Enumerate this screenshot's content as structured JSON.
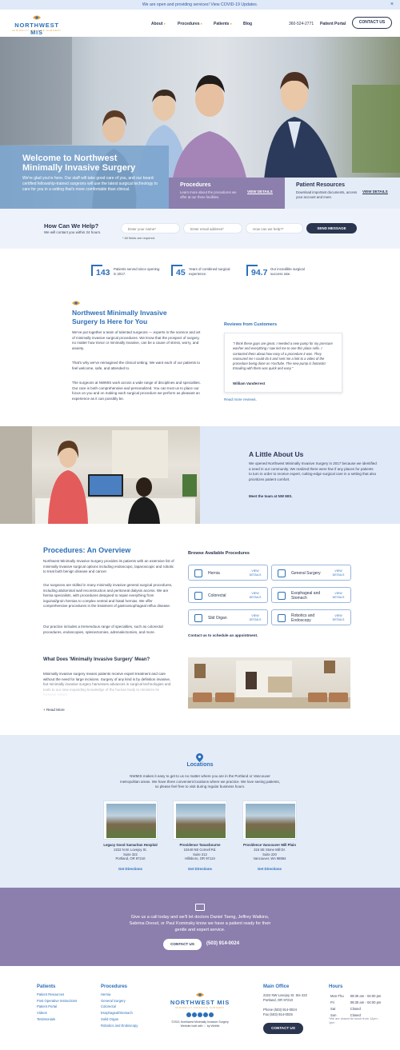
{
  "banner": {
    "text": "We are open and providing services! View COVID-19 Updates.",
    "close": "×"
  },
  "header": {
    "logo_name": "NORTHWEST MIS",
    "logo_tag": "MINIMALLY INVASIVE SURGERY",
    "nav": [
      "About",
      "Procedures",
      "Patients",
      "Blog"
    ],
    "phone": "360-524-2771",
    "portal": "Patient Portal",
    "contact_button": "CONTACT US"
  },
  "hero": {
    "title": "Welcome to Northwest Minimally Invasive Surgery",
    "text": "We're glad you're here. Our staff will take good care of you, and our board-certified fellowship-trained surgeons will use the latest surgical technology to care for you in a setting that's more comfortable than clinical.",
    "procedures": {
      "title": "Procedures",
      "text": "Learn more about the procedures we offer at our three facilities.",
      "link": "VIEW DETAILS"
    },
    "resources": {
      "title": "Patient Resources",
      "text": "Download important documents, access your account and more.",
      "link": "VIEW DETAILS"
    }
  },
  "help": {
    "title": "How Can We Help?",
    "subtitle": "We will contact you within 24 hours.",
    "name_placeholder": "Enter your name*",
    "email_placeholder": "Enter email address*",
    "message_placeholder": "How can we help?*",
    "send": "SEND MESSAGE",
    "required_note": "* All fields are required."
  },
  "stats": [
    {
      "num": "143",
      "label": "Patients served since opening in 2017."
    },
    {
      "num": "45",
      "label": "Years of combined surgical experience."
    },
    {
      "num": "94.7",
      "label": "Our incredible surgical success rate."
    }
  ],
  "intro": {
    "title": "Northwest Minimally Invasive Surgery Is Here for You",
    "p1": "We've put together a team of talented surgeons — experts in the science and art of minimally invasive surgical procedures. We know that the prospect of surgery, no matter how minor or minimally invasive, can be a cause of stress, worry, and anxiety.",
    "p2": "That's why we've reimagined the clinical setting. We want each of our patients to feel welcome, safe, and attended to.",
    "p3": "The surgeons at NWMIS work across a wide range of disciplines and specialties. Our care is both comprehensive and personalized. You can trust us to place our focus on you and on making each surgical procedure we perform as pleasant an experience as it can possibly be."
  },
  "reviews": {
    "title": "Reviews from Customers",
    "quote": "\"I think these guys are great.  I needed a new pump for my pressure washer and everything I saw led me to one this place sells.  I contacted them about how easy of a procedure it was. They reassured me I could do it and sent me a link to a video of the procedure being done on YouTube.  The new pump is fantastic!  Emailing with them was quick and easy.\"",
    "author": "William Vanderrest",
    "more": "Read more reviews."
  },
  "about": {
    "title": "A Little About Us",
    "text": "We opened Northwest Minimally Invasive Surgery in 2017 because we identified a need in our community. We realized there were few if any places for patients to turn in order to receive expert, cutting-edge surgical care in a setting that also prioritizes patient comfort.",
    "link": "Meet the team at NW MIS."
  },
  "procedures": {
    "title": "Procedures: An Overview",
    "p1": "Northwest Minimally Invasive Surgery provides its patients with an extensive list of minimally invasive surgical options including endoscopic, laparoscopic and robotic to treat both benign disease and cancer.",
    "p2": "Our surgeons are skilled in many minimally invasive general surgical procedures, including abdominal wall reconstruction and peritoneal dialysis access.  We are hernia specialists, with procedures designed to repair everything from inguinal/groin hernias to complex ventral and hiatal hernias.  We  offer comprehensive procedures in the treatment of gastroesophageal reflux disease.",
    "p3": "Our practice includes a tremendous range of specialties, such as colorectal procedures, endoscopies, splenectomies, adrenalectomies, and more.",
    "browse_title": "Browse Available Procedures",
    "cards": [
      {
        "name": "Hernia",
        "link": "VIEW DETAILS",
        "icon": "hernia-icon"
      },
      {
        "name": "General Surgery",
        "link": "VIEW DETAILS",
        "icon": "general-surgery-icon"
      },
      {
        "name": "Colorectal",
        "link": "VIEW DETAILS",
        "icon": "colorectal-icon"
      },
      {
        "name": "Esophageal and Stomach",
        "link": "VIEW DETAILS",
        "icon": "stomach-icon"
      },
      {
        "name": "Slid Organ",
        "link": "VIEW DETAILS",
        "icon": "organ-icon"
      },
      {
        "name": "Robotics and Endoscopy",
        "link": "VIEW DETAILS",
        "icon": "robotics-icon"
      }
    ],
    "contact_schedule": "Contact us to schedule an appointment.",
    "mis_title": "What Does 'Minimally Invasive Surgery' Mean?",
    "mis_text": "Minimally invasive surgery means patients receive expert treatment and care without the need for large incisions. Surgery of any kind is by definition invasive, but minimally invasive surgery harnesses advances in surgical technologies and tools to our new expanding knowledge of the human body to minimize its invasive nature.",
    "read_more": "+ Read More"
  },
  "locations": {
    "title": "Locations",
    "text": "NWMIS makes it easy to get to us no matter where you are in the Portland or Vancouver metropolitan areas. We have three convenient locations where we practice. We love seeing patients, so please feel free to visit during regular business hours.",
    "items": [
      {
        "name": "Legacy Good Samaritan Hospital",
        "l1": "2222 N.W. Lovejoy St.",
        "l2": "Suite 322",
        "l3": "Portland, OR 97210",
        "link": "Get Directions"
      },
      {
        "name": "Providence Tanasbourne",
        "l1": "10440 NE Cornell Rd.",
        "l2": "Suite 212",
        "l3": "Hillsboro, OR 97124",
        "link": "Get Directions"
      },
      {
        "name": "Providence Vancouver Mill Plain",
        "l1": "315 SE Stone Mill Dr.",
        "l2": "Suite 220",
        "l3": "Vancouver, WA 98864",
        "link": "Get Directions"
      }
    ]
  },
  "call": {
    "text": "Give us a call today and we'll let doctors Daniel Tseng, Jeffrey Watkins, Sabrina Drexel, or Paul Kominsky know we have a patient ready for their gentle and expert service.",
    "button": "CONTACT US",
    "phone": "(503) 914-0024"
  },
  "footer": {
    "patients_title": "Patients",
    "patients": [
      "Patient Resources",
      "Post Operative Instructions",
      "Patient Portal",
      "Videos",
      "Testimonials"
    ],
    "procedures_title": "Procedures",
    "procedures": [
      "Hernia",
      "General Surgery",
      "Colorectal",
      "Esophageal/Stomach",
      "Solid Organ",
      "Robotics and Endoscopy"
    ],
    "logo_name": "NORTHWEST MIS",
    "logo_tag": "MINIMALLY INVASIVE SURGERY",
    "copyright": "©2021 Northwest Minimally Invasive Surgery",
    "built": "Website built with ♡ by Webfix",
    "office_title": "Main Office",
    "office_l1": "2222 NW Lovejoy St. Ste 222",
    "office_l2": "Portland, OR 97210",
    "office_phone": "Phone (503) 914-0024",
    "office_fax": "Fax (503) 914-0025",
    "office_button": "CONTACT US",
    "hours_title": "Hours",
    "hours": [
      {
        "d": "Mon-Thu",
        "t": "08:30 am - 04:00 pm"
      },
      {
        "d": "Fri",
        "t": "08:30 am - 04:00 pm"
      },
      {
        "d": "Sat",
        "t": "Closed"
      },
      {
        "d": "Sun",
        "t": "Closed"
      }
    ],
    "hours_note": "*We are closed for lunch from 12pm - 1pm"
  },
  "colors": {
    "brand_blue": "#2c6fb8",
    "navy": "#2a3550",
    "purple": "#8c7fad",
    "light_blue": "#e4ecf7",
    "gold": "#e8a33a"
  }
}
